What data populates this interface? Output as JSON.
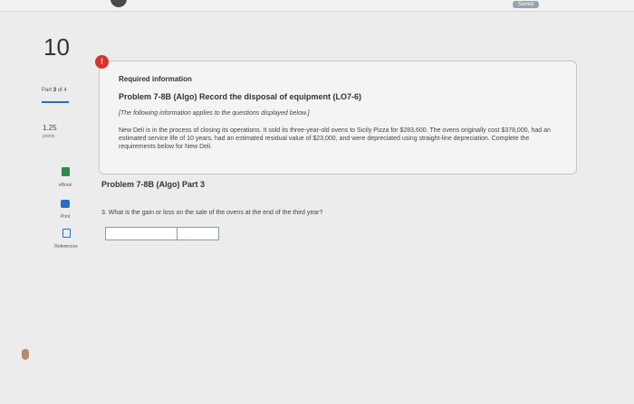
{
  "header": {
    "saved_label": "Saved"
  },
  "question": {
    "number": "10",
    "part_prefix": "Part",
    "part_current": "3",
    "part_total_text": "of 4",
    "points_value": "1.25",
    "points_label": "points"
  },
  "tools": {
    "ebook": "eBook",
    "print": "Print",
    "references": "References"
  },
  "info": {
    "alert_symbol": "!",
    "heading": "Required information",
    "problem_title": "Problem 7-8B (Algo) Record the disposal of equipment (LO7-6)",
    "note": "[The following information applies to the questions displayed below.]",
    "body": "New Deli is in the process of closing its operations. It sold its three-year-old ovens to Sicily Pizza for $283,600. The ovens originally cost $378,000, had an estimated service life of 10 years, had an estimated residual value of $23,000, and were depreciated using straight-line depreciation. Complete the requirements below for New Deli."
  },
  "part3": {
    "title": "Problem 7-8B (Algo) Part 3",
    "question": "3. What is the gain or loss on the sale of the ovens at the end of the third year?"
  },
  "answer": {
    "label_value": "",
    "amount_value": ""
  }
}
